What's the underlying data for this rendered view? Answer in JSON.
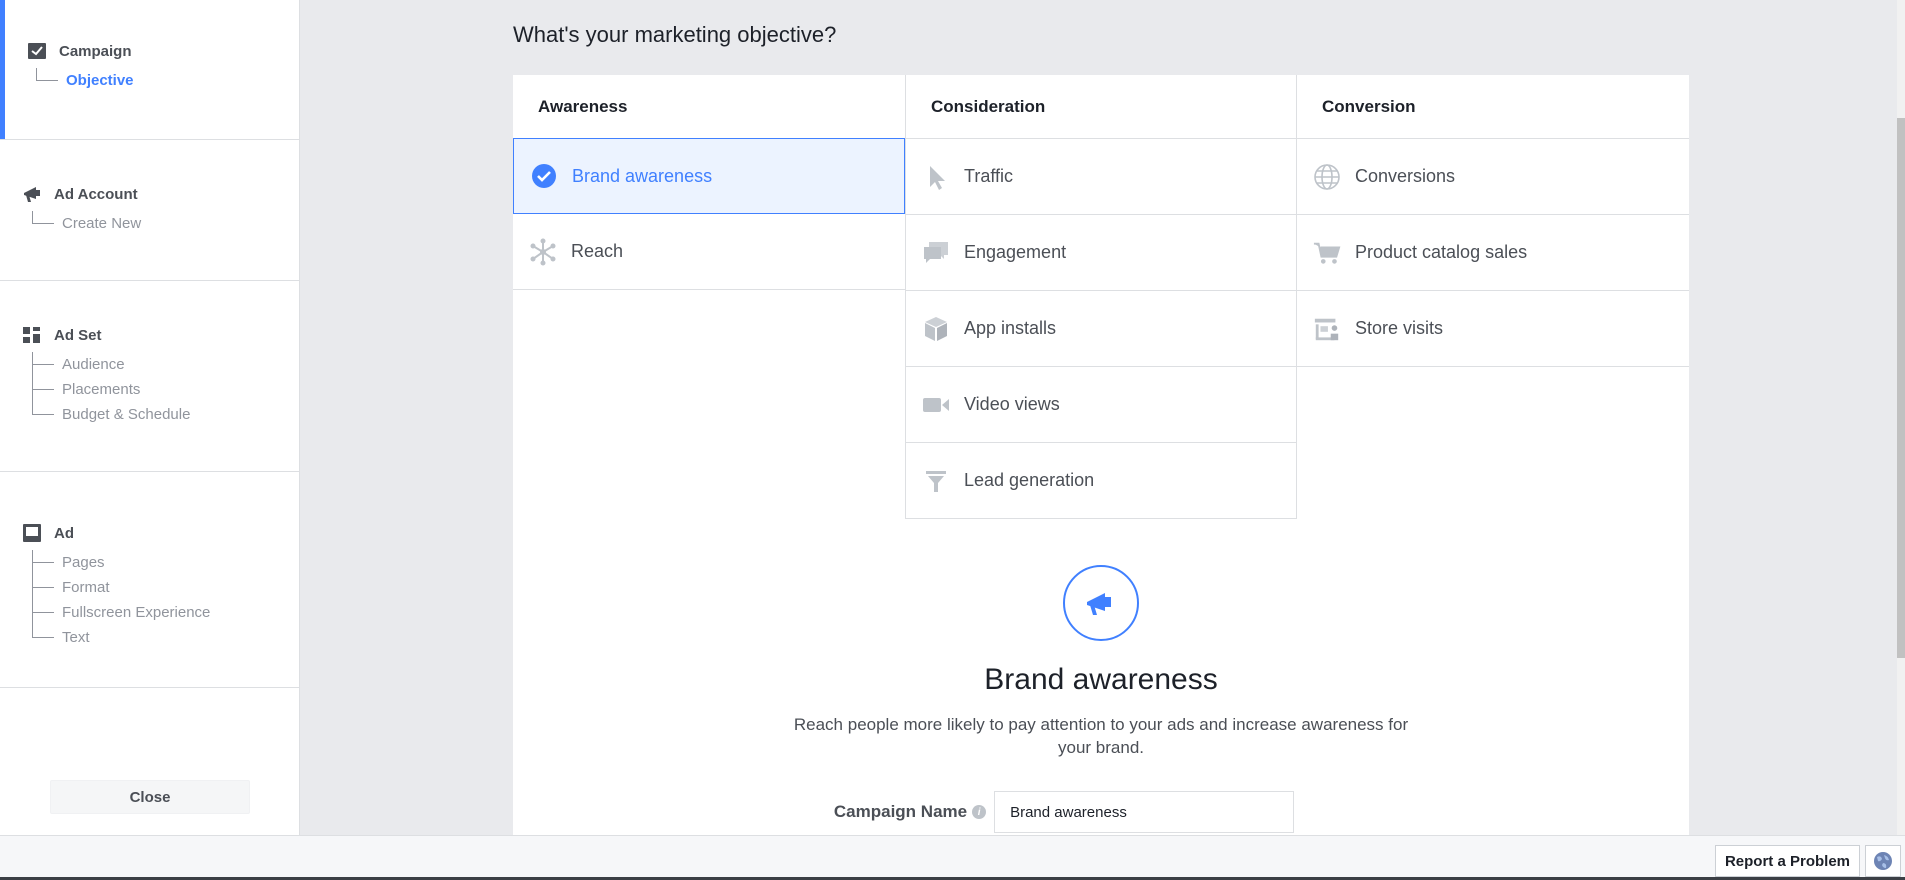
{
  "sidebar": {
    "campaign": {
      "title": "Campaign",
      "items": [
        "Objective"
      ]
    },
    "ad_account": {
      "title": "Ad Account",
      "items": [
        "Create New"
      ]
    },
    "ad_set": {
      "title": "Ad Set",
      "items": [
        "Audience",
        "Placements",
        "Budget & Schedule"
      ]
    },
    "ad": {
      "title": "Ad",
      "items": [
        "Pages",
        "Format",
        "Fullscreen Experience",
        "Text"
      ]
    },
    "close_label": "Close"
  },
  "main": {
    "title": "What's your marketing objective?",
    "columns": [
      {
        "header": "Awareness",
        "options": [
          {
            "label": "Brand awareness",
            "icon": "check-circle-icon",
            "selected": true
          },
          {
            "label": "Reach",
            "icon": "reach-icon"
          }
        ]
      },
      {
        "header": "Consideration",
        "options": [
          {
            "label": "Traffic",
            "icon": "cursor-icon"
          },
          {
            "label": "Engagement",
            "icon": "chat-bubbles-icon"
          },
          {
            "label": "App installs",
            "icon": "box-icon"
          },
          {
            "label": "Video views",
            "icon": "video-camera-icon"
          },
          {
            "label": "Lead generation",
            "icon": "funnel-icon"
          }
        ]
      },
      {
        "header": "Conversion",
        "options": [
          {
            "label": "Conversions",
            "icon": "globe-icon"
          },
          {
            "label": "Product catalog sales",
            "icon": "cart-icon"
          },
          {
            "label": "Store visits",
            "icon": "store-icon"
          }
        ]
      }
    ],
    "detail": {
      "title": "Brand awareness",
      "description": "Reach people more likely to pay attention to your ads and increase awareness for your brand."
    },
    "campaign_name": {
      "label": "Campaign Name",
      "value": "Brand awareness"
    }
  },
  "footer": {
    "report_label": "Report a Problem"
  },
  "colors": {
    "accent": "#4080ff",
    "icon_gray": "#bec3c9",
    "selected_bg": "#ecf3ff"
  }
}
